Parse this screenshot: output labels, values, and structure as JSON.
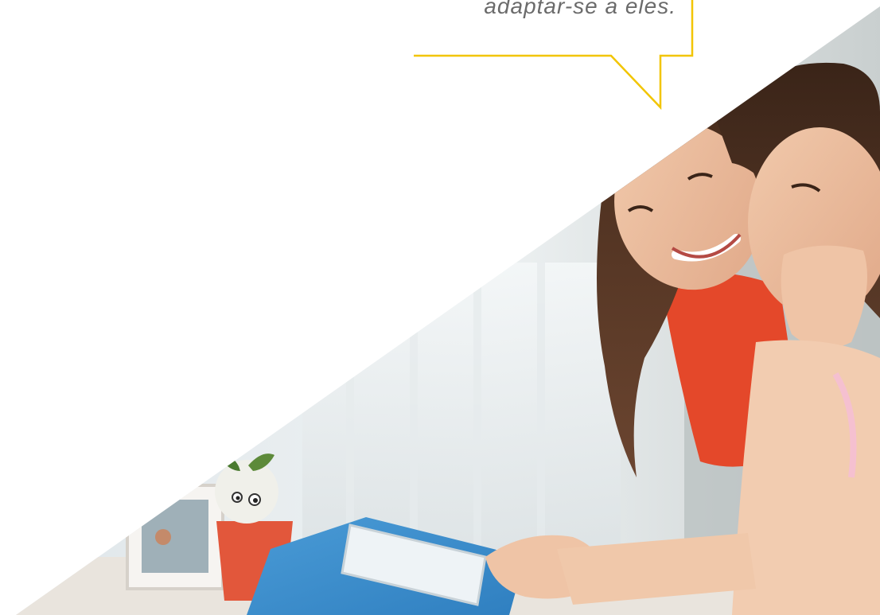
{
  "quote": {
    "visible_line": "adaptar-se a eles."
  },
  "bubble": {
    "border_color": "#f2c500"
  },
  "photo": {
    "subject": "mother-and-daughter-with-tablet"
  }
}
